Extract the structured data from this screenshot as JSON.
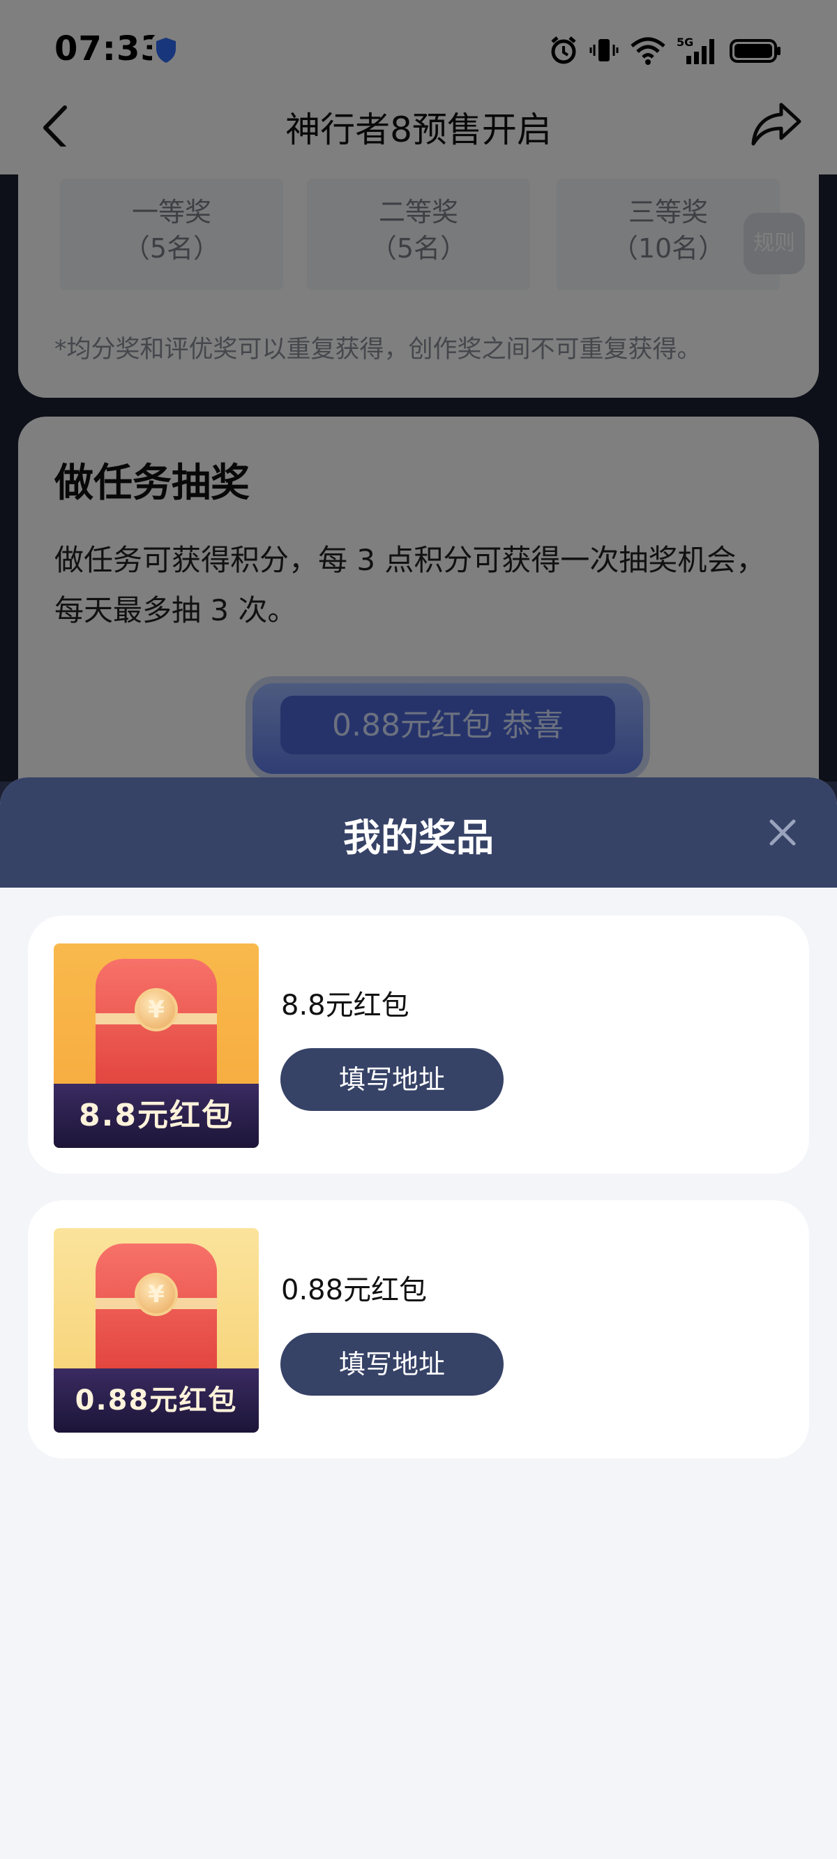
{
  "status_bar": {
    "time": "07:33",
    "network_label": "5G"
  },
  "header": {
    "title": "神行者8预售开启"
  },
  "award_card": {
    "prizes": [
      {
        "name": "一等奖",
        "count": "（5名）"
      },
      {
        "name": "二等奖",
        "count": "（5名）"
      },
      {
        "name": "三等奖",
        "count": "（10名）"
      }
    ],
    "rules_label": "规则",
    "note": "*均分奖和评优奖可以重复获得，创作奖之间不可重复获得。"
  },
  "task_card": {
    "title": "做任务抽奖",
    "description": "做任务可获得积分，每 3 点积分可获得一次抽奖机会，每天最多抽 3 次。",
    "marquee_text": "0.88元红包  恭喜"
  },
  "sheet": {
    "title": "我的奖品",
    "items": [
      {
        "name": "8.8元红包",
        "image_label": "8.8元红包",
        "button_label": "填写地址"
      },
      {
        "name": "0.88元红包",
        "image_label": "0.88元红包",
        "button_label": "填写地址"
      }
    ]
  },
  "colors": {
    "primary": "#364266",
    "sheet_bg": "#f4f5f9",
    "envelope_red": "#e0413a",
    "thumb_label_bg": "#1c1538"
  }
}
